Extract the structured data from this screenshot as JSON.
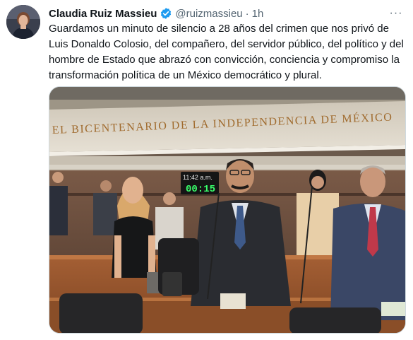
{
  "tweet": {
    "author_name": "Claudia Ruiz Massieu",
    "author_handle": "@ruizmassieu",
    "separator": "·",
    "time": "1h",
    "more_label": "···",
    "text": "Guardamos un minuto de silencio a 28 años del crimen que nos privó de Luis Donaldo Colosio, del compañero, del servidor público, del político y del hombre de Estado que abrazó con convicción, conciencia y compromiso la transformación política de un México democrático y plural."
  },
  "photo": {
    "banner_text": "EL BICENTENARIO DE LA INDEPENDENCIA DE MÉXICO",
    "clock_time": "11:42 a.m.",
    "clock_counter": "00:15"
  },
  "icons": {
    "verified": "verified-badge-icon",
    "more": "more-options-icon"
  },
  "colors": {
    "verified": "#1d9bf0",
    "text_primary": "#0f1419",
    "text_secondary": "#536471",
    "clock_green": "#39ff6a"
  }
}
